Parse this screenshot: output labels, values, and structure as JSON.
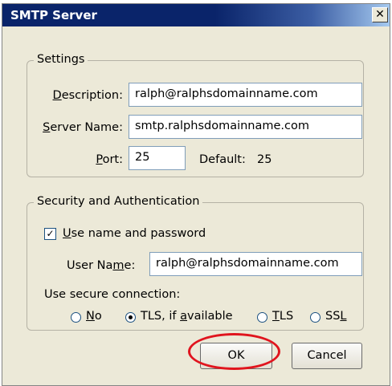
{
  "window": {
    "title": "SMTP Server",
    "close_glyph": "✕"
  },
  "settings": {
    "legend": "Settings",
    "description": {
      "label_pre": "",
      "label_key": "D",
      "label_post": "escription:",
      "value": "ralph@ralphsdomainname.com"
    },
    "server_name": {
      "label_pre": "",
      "label_key": "S",
      "label_post": "erver Name:",
      "value": "smtp.ralphsdomainname.com"
    },
    "port": {
      "label_pre": "",
      "label_key": "P",
      "label_post": "ort:",
      "value": "25"
    },
    "default_label": "Default:",
    "default_value": "25"
  },
  "security": {
    "legend": "Security and Authentication",
    "use_auth": {
      "checked": true,
      "label_pre": "",
      "label_key": "U",
      "label_post": "se name and password"
    },
    "user_name": {
      "label_pre": "User Na",
      "label_key": "m",
      "label_post": "e:",
      "value": "ralph@ralphsdomainname.com"
    },
    "secure_label": "Use secure connection:",
    "options": [
      {
        "pre": "",
        "key": "N",
        "post": "o",
        "checked": false
      },
      {
        "pre": "TLS, if ",
        "key": "a",
        "post": "vailable",
        "checked": true
      },
      {
        "pre": "",
        "key": "T",
        "post": "LS",
        "checked": false
      },
      {
        "pre": "SS",
        "key": "L",
        "post": "",
        "checked": false
      }
    ]
  },
  "buttons": {
    "ok": "OK",
    "cancel": "Cancel"
  },
  "colors": {
    "title_bar": "#0a246a",
    "dialog_bg": "#ece9d8",
    "highlight": "#e0141e"
  },
  "icons": {
    "close": "close-icon",
    "check": "checkmark-icon"
  }
}
